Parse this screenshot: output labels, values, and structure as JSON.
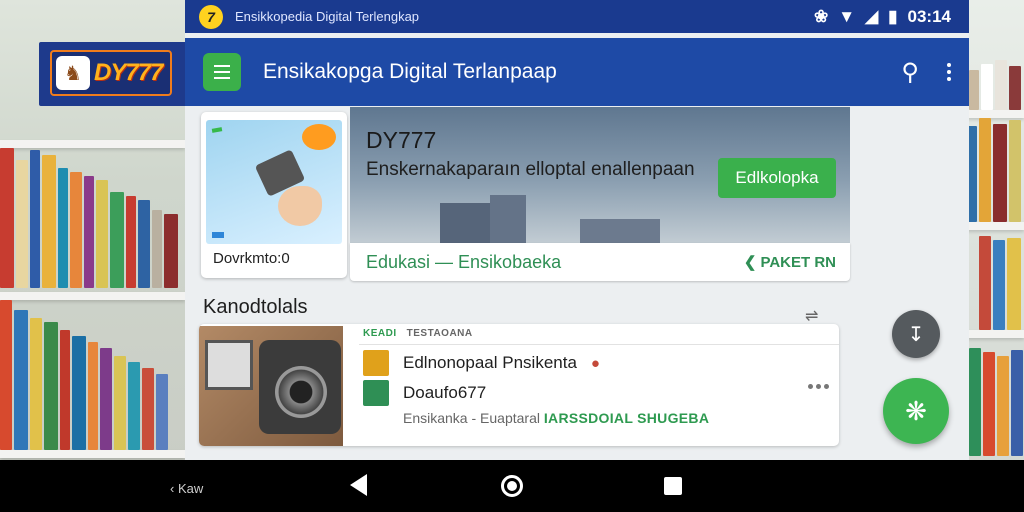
{
  "status_bar": {
    "coin_icon": "coin-7-icon",
    "title": "Ensikkopedia Digital Terlengkap",
    "time": "03:14"
  },
  "brand": {
    "logo_text": "DY777"
  },
  "app_bar": {
    "title": "Ensikakopga Digital Terlanpaap",
    "menu_icon": "menu-icon",
    "search_icon": "search-icon",
    "more_icon": "more-vert-icon",
    "accent": "#3bb04a",
    "bar_color": "#1e4aa6"
  },
  "hero": {
    "thumb_label": "Dovrkmto:0",
    "title": "DY777",
    "subtitle": "Enskernakaparaın elloptal enallenpaan",
    "button_label": "Edlkolopka",
    "edu_text": "Edukasi — Ensikobaeka",
    "edu_link": "PAKET RN"
  },
  "section": {
    "title": "Kanodtolals",
    "category_new": "KEADI",
    "category_name": "TESTAOANA",
    "items": [
      {
        "label": "Edlnonopaal Pnsikenta",
        "color": "#e0a11b"
      },
      {
        "label": "Doaufo677",
        "color": "#2f8f55"
      }
    ],
    "meta_left": "Ensikanka  -  Euaptaral",
    "meta_right": "IARSSDOIAL SHUGEBA"
  },
  "navbar": {
    "left_text": "‹ Kaw"
  }
}
